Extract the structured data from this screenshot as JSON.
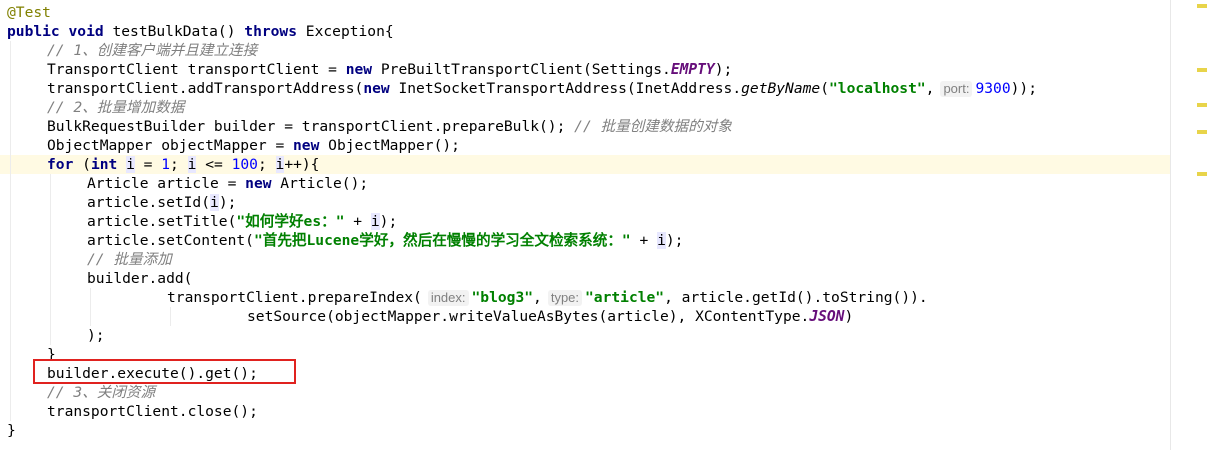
{
  "code": {
    "annotation": "@Test",
    "l2_kw1": "public",
    "l2_kw2": "void",
    "l2_name": "testBulkData()",
    "l2_kw3": "throws",
    "l2_tail": "Exception{",
    "l3_comment": "// 1、创建客户端并且建立连接",
    "l4_a": "TransportClient transportClient = ",
    "l4_new": "new",
    "l4_b": " PreBuiltTransportClient(Settings.",
    "l4_static": "EMPTY",
    "l4_c": ");",
    "l5_a": "transportClient.addTransportAddress(",
    "l5_new": "new",
    "l5_b": " InetSocketTransportAddress(InetAddress.",
    "l5_method": "getByName",
    "l5_c": "(",
    "l5_str": "\"localhost\"",
    "l5_d": ",",
    "l5_hint": "port:",
    "l5_num": "9300",
    "l5_e": "));",
    "l6_comment": "// 2、批量增加数据",
    "l7_a": "BulkRequestBuilder builder = transportClient.prepareBulk(); ",
    "l7_comment": "// 批量创建数据的对象",
    "l8_a": "ObjectMapper objectMapper = ",
    "l8_new": "new",
    "l8_b": " ObjectMapper();",
    "l9_for": "for",
    "l9_a": " (",
    "l9_int": "int",
    "l9_sp": " ",
    "l9_i1": "i",
    "l9_b": " = ",
    "l9_n1": "1",
    "l9_c": "; ",
    "l9_i2": "i",
    "l9_d": " <= ",
    "l9_n2": "100",
    "l9_e": "; ",
    "l9_i3": "i",
    "l9_f": "++){",
    "l10_a": "Article article = ",
    "l10_new": "new",
    "l10_b": " Article();",
    "l11_a": "article.setId(",
    "l11_i": "i",
    "l11_b": ");",
    "l12_a": "article.setTitle(",
    "l12_str": "\"如何学好es：\"",
    "l12_b": " + ",
    "l12_i": "i",
    "l12_c": ");",
    "l13_a": "article.setContent(",
    "l13_str": "\"首先把Lucene学好，然后在慢慢的学习全文检索系统：\"",
    "l13_b": " + ",
    "l13_i": "i",
    "l13_c": ");",
    "l14_comment": "// 批量添加",
    "l15_a": "builder.add(",
    "l16_a": "transportClient.prepareIndex(",
    "l16_hint1": "index:",
    "l16_str1": "\"blog3\"",
    "l16_b": ",",
    "l16_hint2": "type:",
    "l16_str2": "\"article\"",
    "l16_c": ", article.getId().toString()).",
    "l17_a": "setSource(objectMapper.writeValueAsBytes(article), XContentType.",
    "l17_static": "JSON",
    "l17_b": ")",
    "l18_a": ");",
    "l19_a": "}",
    "l20_a": "builder.execute().get();",
    "l21_comment": "// 3、关闭资源",
    "l22_a": "transportClient.close();",
    "l23_a": "}"
  },
  "colors": {
    "keyword": "#000080",
    "string": "#008000",
    "comment": "#808080",
    "number": "#0000ff",
    "annotation": "#808000",
    "static_field": "#660e7a",
    "current_line": "#fffae3",
    "highlight_box": "#e0221f",
    "warning_marker": "#e8d44a"
  }
}
